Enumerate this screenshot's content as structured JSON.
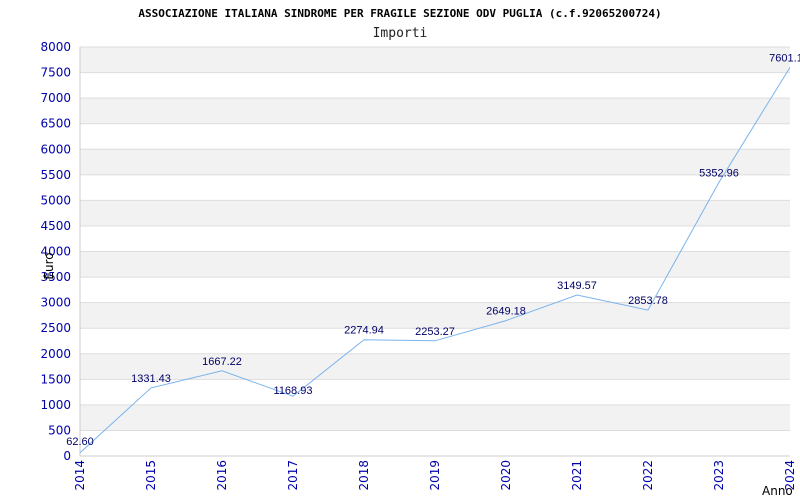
{
  "chart_data": {
    "type": "line",
    "title": "ASSOCIAZIONE ITALIANA SINDROME PER FRAGILE SEZIONE ODV PUGLIA (c.f.92065200724)",
    "subtitle": "Importi",
    "xlabel": "Anno",
    "ylabel": "Euro",
    "x": [
      "2014",
      "2015",
      "2016",
      "2017",
      "2018",
      "2019",
      "2020",
      "2021",
      "2022",
      "2023",
      "2024"
    ],
    "values": [
      62.6,
      1331.43,
      1667.22,
      1168.93,
      2274.94,
      2253.27,
      2649.18,
      3149.57,
      2853.78,
      5352.96,
      7601.1
    ],
    "data_labels": [
      "62.60",
      "1331.43",
      "1667.22",
      "1168.93",
      "2274.94",
      "2253.27",
      "2649.18",
      "3149.57",
      "2853.78",
      "5352.96",
      "7601.1"
    ],
    "ylim": [
      0,
      8000
    ],
    "yticks": [
      "0",
      "500",
      "1000",
      "1500",
      "2000",
      "2500",
      "3000",
      "3500",
      "4000",
      "4500",
      "5000",
      "5500",
      "6000",
      "6500",
      "7000",
      "7500",
      "8000"
    ],
    "grid": true,
    "colors": {
      "line": "#7ab4ec",
      "band": "#f2f2f2",
      "grid": "#dddddd",
      "tick": "#0000aa",
      "label": "#000066"
    }
  }
}
